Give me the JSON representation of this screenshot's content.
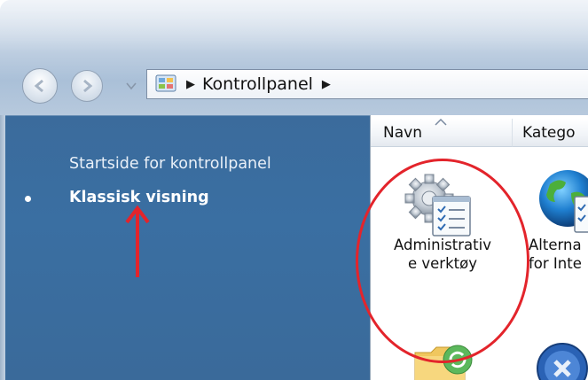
{
  "address_bar": {
    "path": [
      "Kontrollpanel"
    ]
  },
  "left_pane": {
    "home_link": "Startside for kontrollpanel",
    "current_view": "Klassisk visning"
  },
  "columns": {
    "name": "Navn",
    "category": "Katego"
  },
  "items": [
    {
      "label_line1": "Administrativ",
      "label_line2": "e verktøy",
      "icon": "admin-tools-icon"
    },
    {
      "label_line1": "Alterna",
      "label_line2": "for Inte",
      "icon": "globe-icon"
    }
  ],
  "colors": {
    "pane": "#3a6a9a",
    "annotation": "#e3242b"
  }
}
